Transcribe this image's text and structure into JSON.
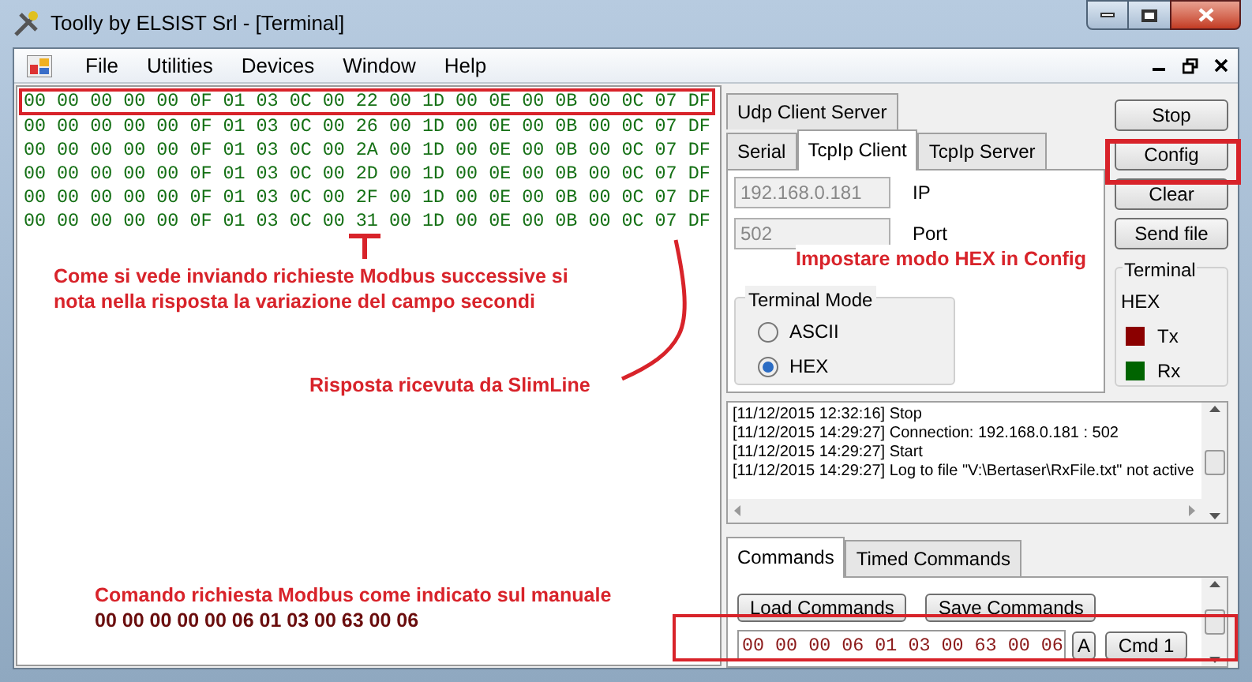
{
  "window": {
    "title": "Toolly by ELSIST Srl - [Terminal]"
  },
  "menu": [
    "File",
    "Utilities",
    "Devices",
    "Window",
    "Help"
  ],
  "terminal": {
    "lines": [
      {
        "text": "00 00 00 00 00 0F 01 03 0C 00 22 00 1D 00 0E 00 0B 00 0C 07 DF",
        "highlighted": true
      },
      {
        "text": "00 00 00 00 00 0F 01 03 0C 00 26 00 1D 00 0E 00 0B 00 0C 07 DF",
        "highlighted": false
      },
      {
        "text": "00 00 00 00 00 0F 01 03 0C 00 2A 00 1D 00 0E 00 0B 00 0C 07 DF",
        "highlighted": false
      },
      {
        "text": "00 00 00 00 00 0F 01 03 0C 00 2D 00 1D 00 0E 00 0B 00 0C 07 DF",
        "highlighted": false
      },
      {
        "text": "00 00 00 00 00 0F 01 03 0C 00 2F 00 1D 00 0E 00 0B 00 0C 07 DF",
        "highlighted": false
      },
      {
        "text": "00 00 00 00 00 0F 01 03 0C 00 31 00 1D 00 0E 00 0B 00 0C 07 DF",
        "highlighted": false
      }
    ]
  },
  "connection_tabs": [
    {
      "label": "Udp Client Server",
      "selected": false
    },
    {
      "label": "Serial",
      "selected": false
    },
    {
      "label": "TcpIp Client",
      "selected": true
    },
    {
      "label": "TcpIp Server",
      "selected": false
    }
  ],
  "ip": {
    "value": "192.168.0.181",
    "label": "IP",
    "disabled": true
  },
  "port": {
    "value": "502",
    "label": "Port",
    "disabled": true
  },
  "terminal_mode": {
    "title": "Terminal Mode",
    "options": [
      {
        "label": "ASCII",
        "selected": false
      },
      {
        "label": "HEX",
        "selected": true
      }
    ]
  },
  "buttons": [
    "Stop",
    "Config",
    "Clear",
    "Send file"
  ],
  "terminal_status": {
    "title": "Terminal",
    "mode": "HEX",
    "signals": [
      {
        "label": "Tx",
        "color": "#8b0000"
      },
      {
        "label": "Rx",
        "color": "#006400"
      }
    ]
  },
  "log": [
    "[11/12/2015 12:32:16] Stop",
    "[11/12/2015 14:29:27] Connection: 192.168.0.181 : 502",
    "[11/12/2015 14:29:27] Start",
    "[11/12/2015 14:29:27] Log to file \"V:\\Bertaser\\RxFile.txt\" not active"
  ],
  "command_tabs": [
    {
      "label": "Commands",
      "selected": true
    },
    {
      "label": "Timed Commands",
      "selected": false
    }
  ],
  "commands": {
    "load": "Load Commands",
    "save": "Save Commands",
    "value": "00 00 00 06 01 03 00 63 00 06",
    "mode": "A",
    "send": "Cmd 1"
  },
  "annotations": {
    "seconds": "Come si vede inviando richieste Modbus successive si nota nella risposta la variazione del campo secondi",
    "response": "Risposta ricevuta da SlimLine",
    "config": "Impostare modo HEX in Config",
    "command": "Comando richiesta Modbus come indicato sul manuale",
    "command_bytes": "00 00 00 00 00 06 01 03 00 63 00 06"
  }
}
